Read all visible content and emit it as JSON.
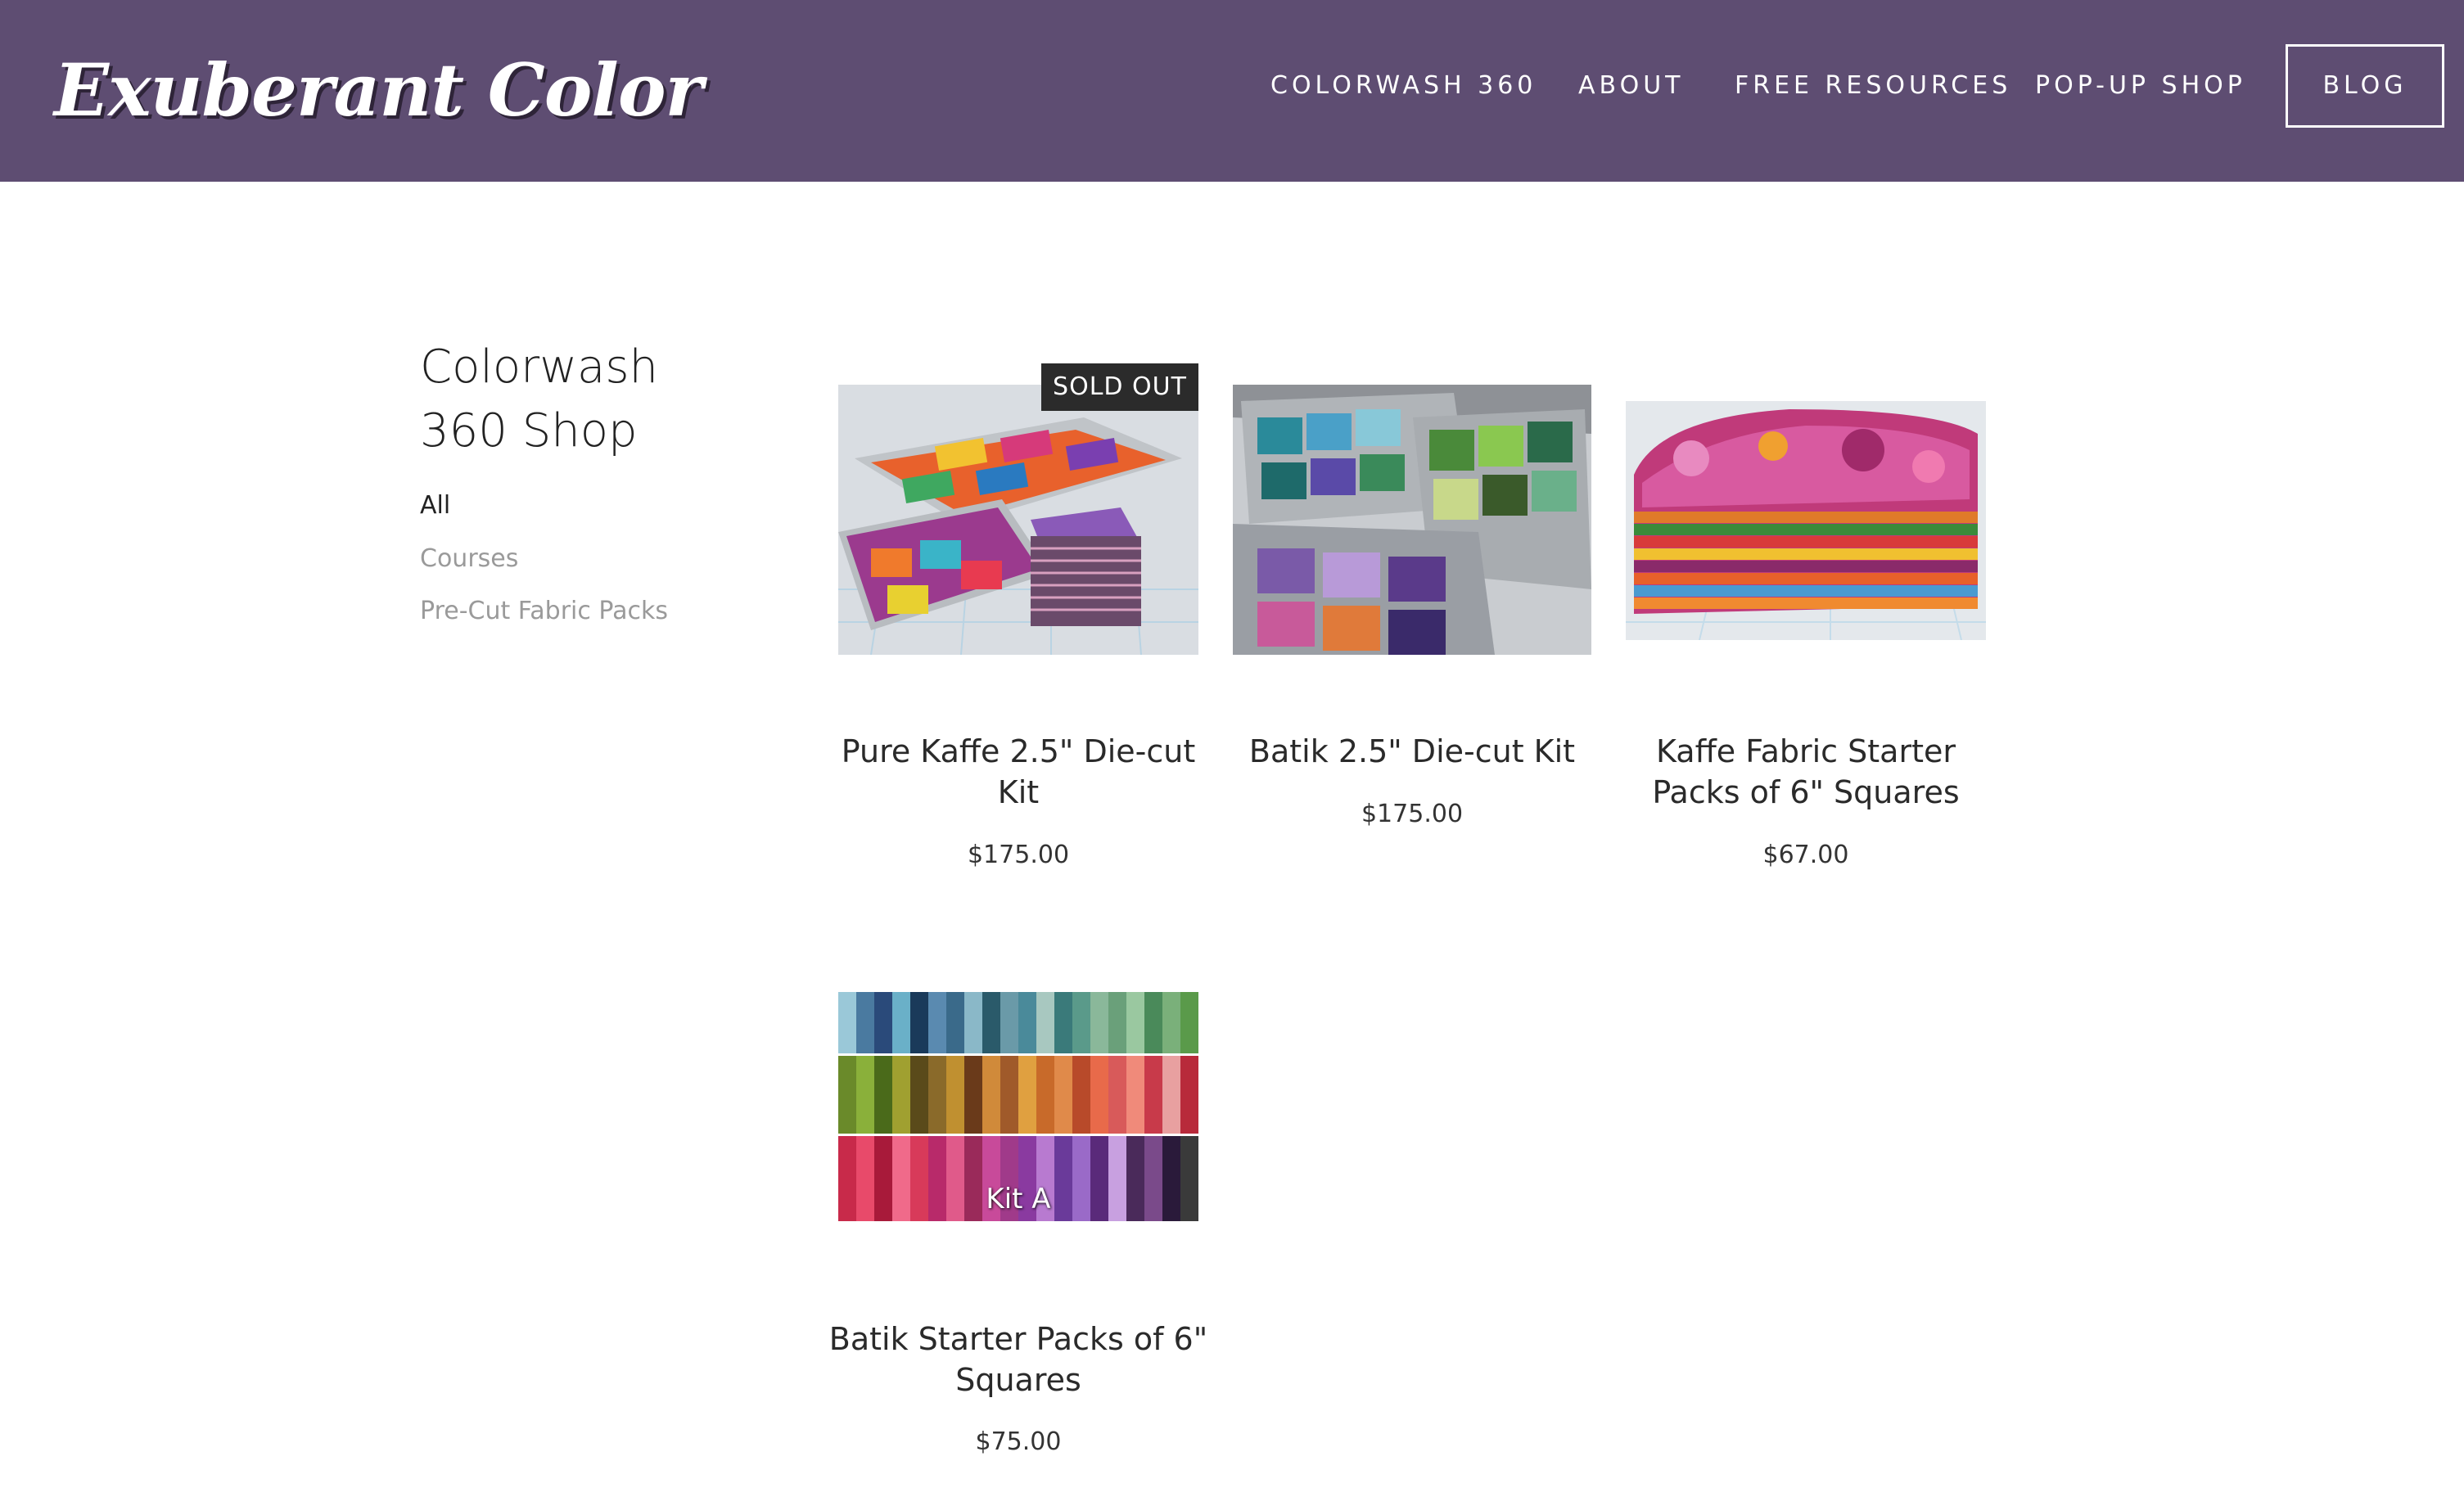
{
  "header": {
    "logo": "Exuberant Color",
    "nav": [
      {
        "label": "COLORWASH 360"
      },
      {
        "label": "ABOUT"
      },
      {
        "label": "FREE RESOURCES"
      },
      {
        "label": "POP-UP SHOP"
      },
      {
        "label": "BLOG"
      }
    ],
    "background_color": "#5e4d72"
  },
  "sidebar": {
    "title_line1": "Colorwash",
    "title_line2": "360 Shop",
    "categories": [
      {
        "label": "All",
        "active": true
      },
      {
        "label": "Courses",
        "active": false
      },
      {
        "label": "Pre-Cut Fabric Packs",
        "active": false
      }
    ]
  },
  "products": [
    {
      "title": "Pure Kaffe 2.5\" Die-cut Kit",
      "price": "$175.00",
      "badge": "SOLD OUT",
      "image_icon": "fabric-trays-bright"
    },
    {
      "title": "Batik 2.5\" Die-cut Kit",
      "price": "$175.00",
      "image_icon": "fabric-trays-batik"
    },
    {
      "title": "Kaffe Fabric Starter Packs of 6\" Squares",
      "price": "$67.00",
      "image_icon": "fabric-stack"
    },
    {
      "title": "Batik Starter Packs of 6\" Squares",
      "price": "$75.00",
      "image_overlay": "Kit A",
      "image_icon": "fabric-strips"
    }
  ]
}
